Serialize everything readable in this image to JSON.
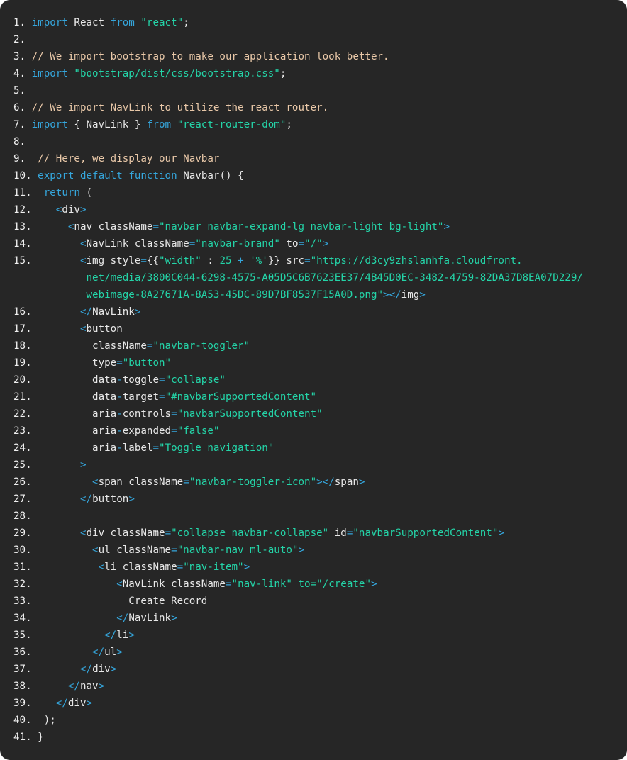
{
  "editor": {
    "background": "#262626",
    "colors": {
      "keyword": "#35a6dc",
      "string": "#24d4a8",
      "comment": "#e9c8a8",
      "text": "#e8e8e8"
    },
    "lines": [
      [
        [
          "ln",
          "1. "
        ],
        [
          "kw",
          "import"
        ],
        [
          "txt",
          " React "
        ],
        [
          "kw",
          "from"
        ],
        [
          "txt",
          " "
        ],
        [
          "str",
          "\"react\""
        ],
        [
          "txt",
          ";"
        ]
      ],
      [
        [
          "ln",
          "2. "
        ]
      ],
      [
        [
          "ln",
          "3. "
        ],
        [
          "com",
          "// We import bootstrap to make our application look better."
        ]
      ],
      [
        [
          "ln",
          "4. "
        ],
        [
          "kw",
          "import"
        ],
        [
          "txt",
          " "
        ],
        [
          "str",
          "\"bootstrap/dist/css/bootstrap.css\""
        ],
        [
          "txt",
          ";"
        ]
      ],
      [
        [
          "ln",
          "5. "
        ]
      ],
      [
        [
          "ln",
          "6. "
        ],
        [
          "com",
          "// We import NavLink to utilize the react router."
        ]
      ],
      [
        [
          "ln",
          "7. "
        ],
        [
          "kw",
          "import"
        ],
        [
          "txt",
          " { NavLink } "
        ],
        [
          "kw",
          "from"
        ],
        [
          "txt",
          " "
        ],
        [
          "str",
          "\"react-router-dom\""
        ],
        [
          "txt",
          ";"
        ]
      ],
      [
        [
          "ln",
          "8. "
        ]
      ],
      [
        [
          "ln",
          "9.  "
        ],
        [
          "com",
          "// Here, we display our Navbar"
        ]
      ],
      [
        [
          "ln",
          "10. "
        ],
        [
          "kw",
          "export"
        ],
        [
          "txt",
          " "
        ],
        [
          "kw",
          "default"
        ],
        [
          "txt",
          " "
        ],
        [
          "kw",
          "function"
        ],
        [
          "txt",
          " Navbar() {"
        ]
      ],
      [
        [
          "ln",
          "11.  "
        ],
        [
          "kw",
          "return"
        ],
        [
          "txt",
          " ("
        ]
      ],
      [
        [
          "ln",
          "12.    "
        ],
        [
          "tag",
          "<"
        ],
        [
          "txt",
          "div"
        ],
        [
          "tag",
          ">"
        ]
      ],
      [
        [
          "ln",
          "13.      "
        ],
        [
          "tag",
          "<"
        ],
        [
          "txt",
          "nav className"
        ],
        [
          "op",
          "="
        ],
        [
          "str",
          "\"navbar navbar-expand-lg navbar-light bg-light\""
        ],
        [
          "tag",
          ">"
        ]
      ],
      [
        [
          "ln",
          "14.        "
        ],
        [
          "tag",
          "<"
        ],
        [
          "txt",
          "NavLink className"
        ],
        [
          "op",
          "="
        ],
        [
          "str",
          "\"navbar-brand\""
        ],
        [
          "txt",
          " to"
        ],
        [
          "op",
          "="
        ],
        [
          "str",
          "\"/\""
        ],
        [
          "tag",
          ">"
        ]
      ],
      [
        [
          "ln",
          "15.        "
        ],
        [
          "tag",
          "<"
        ],
        [
          "txt",
          "img style"
        ],
        [
          "op",
          "="
        ],
        [
          "txt",
          "{{"
        ],
        [
          "str",
          "\"width\""
        ],
        [
          "txt",
          " : "
        ],
        [
          "num",
          "25"
        ],
        [
          "txt",
          " "
        ],
        [
          "op",
          "+"
        ],
        [
          "txt",
          " "
        ],
        [
          "str",
          "'%'"
        ],
        [
          "txt",
          "}} src"
        ],
        [
          "op",
          "="
        ],
        [
          "str",
          "\"https://d3cy9zhslanhfa.cloudfront."
        ]
      ],
      [
        [
          "ln",
          "            "
        ],
        [
          "str",
          "net/media/3800C044-6298-4575-A05D5C6B7623EE37/4B45D0EC-3482-4759-82DA37D8EA07D229/"
        ]
      ],
      [
        [
          "ln",
          "            "
        ],
        [
          "str",
          "webimage-8A27671A-8A53-45DC-89D7BF8537F15A0D.png\""
        ],
        [
          "tag",
          "></"
        ],
        [
          "txt",
          "img"
        ],
        [
          "tag",
          ">"
        ]
      ],
      [
        [
          "ln",
          "16.        "
        ],
        [
          "tag",
          "</"
        ],
        [
          "txt",
          "NavLink"
        ],
        [
          "tag",
          ">"
        ]
      ],
      [
        [
          "ln",
          "17.        "
        ],
        [
          "tag",
          "<"
        ],
        [
          "txt",
          "button"
        ]
      ],
      [
        [
          "ln",
          "18.          "
        ],
        [
          "txt",
          "className"
        ],
        [
          "op",
          "="
        ],
        [
          "str",
          "\"navbar-toggler\""
        ]
      ],
      [
        [
          "ln",
          "19.          "
        ],
        [
          "txt",
          "type"
        ],
        [
          "op",
          "="
        ],
        [
          "str",
          "\"button\""
        ]
      ],
      [
        [
          "ln",
          "20.          "
        ],
        [
          "txt",
          "data"
        ],
        [
          "op",
          "-"
        ],
        [
          "txt",
          "toggle"
        ],
        [
          "op",
          "="
        ],
        [
          "str",
          "\"collapse\""
        ]
      ],
      [
        [
          "ln",
          "21.          "
        ],
        [
          "txt",
          "data"
        ],
        [
          "op",
          "-"
        ],
        [
          "txt",
          "target"
        ],
        [
          "op",
          "="
        ],
        [
          "str",
          "\"#navbarSupportedContent\""
        ]
      ],
      [
        [
          "ln",
          "22.          "
        ],
        [
          "txt",
          "aria"
        ],
        [
          "op",
          "-"
        ],
        [
          "txt",
          "controls"
        ],
        [
          "op",
          "="
        ],
        [
          "str",
          "\"navbarSupportedContent\""
        ]
      ],
      [
        [
          "ln",
          "23.          "
        ],
        [
          "txt",
          "aria"
        ],
        [
          "op",
          "-"
        ],
        [
          "txt",
          "expanded"
        ],
        [
          "op",
          "="
        ],
        [
          "str",
          "\"false\""
        ]
      ],
      [
        [
          "ln",
          "24.          "
        ],
        [
          "txt",
          "aria"
        ],
        [
          "op",
          "-"
        ],
        [
          "txt",
          "label"
        ],
        [
          "op",
          "="
        ],
        [
          "str",
          "\"Toggle navigation\""
        ]
      ],
      [
        [
          "ln",
          "25.        "
        ],
        [
          "tag",
          ">"
        ]
      ],
      [
        [
          "ln",
          "26.          "
        ],
        [
          "tag",
          "<"
        ],
        [
          "txt",
          "span className"
        ],
        [
          "op",
          "="
        ],
        [
          "str",
          "\"navbar-toggler-icon\""
        ],
        [
          "tag",
          "></"
        ],
        [
          "txt",
          "span"
        ],
        [
          "tag",
          ">"
        ]
      ],
      [
        [
          "ln",
          "27.        "
        ],
        [
          "tag",
          "</"
        ],
        [
          "txt",
          "button"
        ],
        [
          "tag",
          ">"
        ]
      ],
      [
        [
          "ln",
          "28."
        ]
      ],
      [
        [
          "ln",
          "29.        "
        ],
        [
          "tag",
          "<"
        ],
        [
          "txt",
          "div className"
        ],
        [
          "op",
          "="
        ],
        [
          "str",
          "\"collapse navbar-collapse\""
        ],
        [
          "txt",
          " id"
        ],
        [
          "op",
          "="
        ],
        [
          "str",
          "\"navbarSupportedContent\""
        ],
        [
          "tag",
          ">"
        ]
      ],
      [
        [
          "ln",
          "30.          "
        ],
        [
          "tag",
          "<"
        ],
        [
          "txt",
          "ul className"
        ],
        [
          "op",
          "="
        ],
        [
          "str",
          "\"navbar-nav ml-auto\""
        ],
        [
          "tag",
          ">"
        ]
      ],
      [
        [
          "ln",
          "31.           "
        ],
        [
          "tag",
          "<"
        ],
        [
          "txt",
          "li className"
        ],
        [
          "op",
          "="
        ],
        [
          "str",
          "\"nav-item\""
        ],
        [
          "tag",
          ">"
        ]
      ],
      [
        [
          "ln",
          "32.              "
        ],
        [
          "tag",
          "<"
        ],
        [
          "txt",
          "NavLink className"
        ],
        [
          "op",
          "="
        ],
        [
          "str",
          "\"nav-link\""
        ],
        [
          "txt",
          " "
        ],
        [
          "str",
          "to=\"/create\""
        ],
        [
          "tag",
          ">"
        ]
      ],
      [
        [
          "ln",
          "33.                "
        ],
        [
          "txt",
          "Create Record"
        ]
      ],
      [
        [
          "ln",
          "34.              "
        ],
        [
          "tag",
          "</"
        ],
        [
          "txt",
          "NavLink"
        ],
        [
          "tag",
          ">"
        ]
      ],
      [
        [
          "ln",
          "35.            "
        ],
        [
          "tag",
          "</"
        ],
        [
          "txt",
          "li"
        ],
        [
          "tag",
          ">"
        ]
      ],
      [
        [
          "ln",
          "36.          "
        ],
        [
          "tag",
          "</"
        ],
        [
          "txt",
          "ul"
        ],
        [
          "tag",
          ">"
        ]
      ],
      [
        [
          "ln",
          "37.        "
        ],
        [
          "tag",
          "</"
        ],
        [
          "txt",
          "div"
        ],
        [
          "tag",
          ">"
        ]
      ],
      [
        [
          "ln",
          "38.      "
        ],
        [
          "tag",
          "</"
        ],
        [
          "txt",
          "nav"
        ],
        [
          "tag",
          ">"
        ]
      ],
      [
        [
          "ln",
          "39.    "
        ],
        [
          "tag",
          "</"
        ],
        [
          "txt",
          "div"
        ],
        [
          "tag",
          ">"
        ]
      ],
      [
        [
          "ln",
          "40.  "
        ],
        [
          "txt",
          ");"
        ]
      ],
      [
        [
          "ln",
          "41. "
        ],
        [
          "txt",
          "}"
        ]
      ]
    ]
  }
}
